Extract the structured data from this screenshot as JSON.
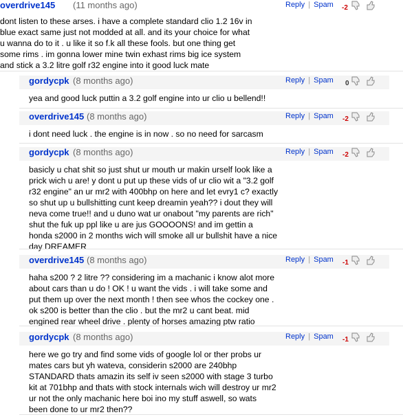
{
  "colors": {
    "username": "#0033cc",
    "timestamp": "#666666",
    "negative_score": "#cc0000",
    "neutral_score": "#333333"
  },
  "actions": {
    "reply_label": "Reply",
    "separator": "|",
    "spam_label": "Spam"
  },
  "comments": [
    {
      "user": "overdrive145",
      "time": "(11 months ago)",
      "score": "-2",
      "is_reply": false,
      "lines": [
        "dont listen to these arses. i have a complete standard clio 1.2 16v in",
        "blue exact same just not modded at all. and its your choice for what",
        "u wanna do to it . u like it so f.k all these fools. but one thing get",
        "some rims . im gonna lower mine twin exhast rims big ice system",
        "and stick a 3.2 litre golf r32 engine into it good luck mate"
      ]
    },
    {
      "user": "gordycpk",
      "time": "(8 months ago)",
      "score": "0",
      "is_reply": true,
      "lines": [
        "yea and good luck puttin a 3.2 golf engine into ur clio u bellend!!"
      ]
    },
    {
      "user": "overdrive145",
      "time": "(8 months ago)",
      "score": "-2",
      "is_reply": true,
      "lines": [
        "i dont need luck . the engine is in now . so no need for sarcasm"
      ]
    },
    {
      "user": "gordycpk",
      "time": "(8 months ago)",
      "score": "-2",
      "is_reply": true,
      "lines": [
        "basicly u chat shit so just shut ur mouth ur makin urself look like a",
        "prick wich u are! y dont u put up these vids of ur clio wit a \"3.2 golf",
        "r32 engine\" an ur mr2 with 400bhp on here and let evry1 c? exactly",
        "so shut up u bullshitting cunt keep dreamin yeah?? i dout they will",
        "neva come true!! and u duno wat ur onabout \"my parents are rich\"",
        "shut the fuk up ppl like u are jus GOOOONS! and im gettin a",
        "honda s2000 in 2 months wich will smoke all ur bullshit have a nice",
        "day DREAMER"
      ]
    },
    {
      "user": "overdrive145",
      "time": "(8 months ago)",
      "score": "-1",
      "is_reply": true,
      "lines": [
        "haha s200 ? 2 litre ?? considering im a machanic i know alot more",
        "about cars than u do ! OK ! u want the vids . i will take some and",
        "put them up over the next month ! then see whos the cockey one .",
        "ok s200 is better than the clio . but the mr2 u cant beat. mid",
        "engined rear wheel drive . plenty of horses amazing ptw ratio"
      ]
    },
    {
      "user": "gordycpk",
      "time": "(8 months ago)",
      "score": "-1",
      "is_reply": true,
      "lines": [
        "here we go try and find some vids of google lol or ther probs ur",
        "mates cars but yh wateva, considerin s2000 are 240bhp",
        "STANDARD thats amazin its self iv seen s2000 with stage 3 turbo",
        "kit at 701bhp and thats with stock internals wich will destroy ur mr2",
        "ur not the only machanic here boi ino my stuff aswell, so wats",
        "been done to ur mr2 then??"
      ]
    }
  ]
}
